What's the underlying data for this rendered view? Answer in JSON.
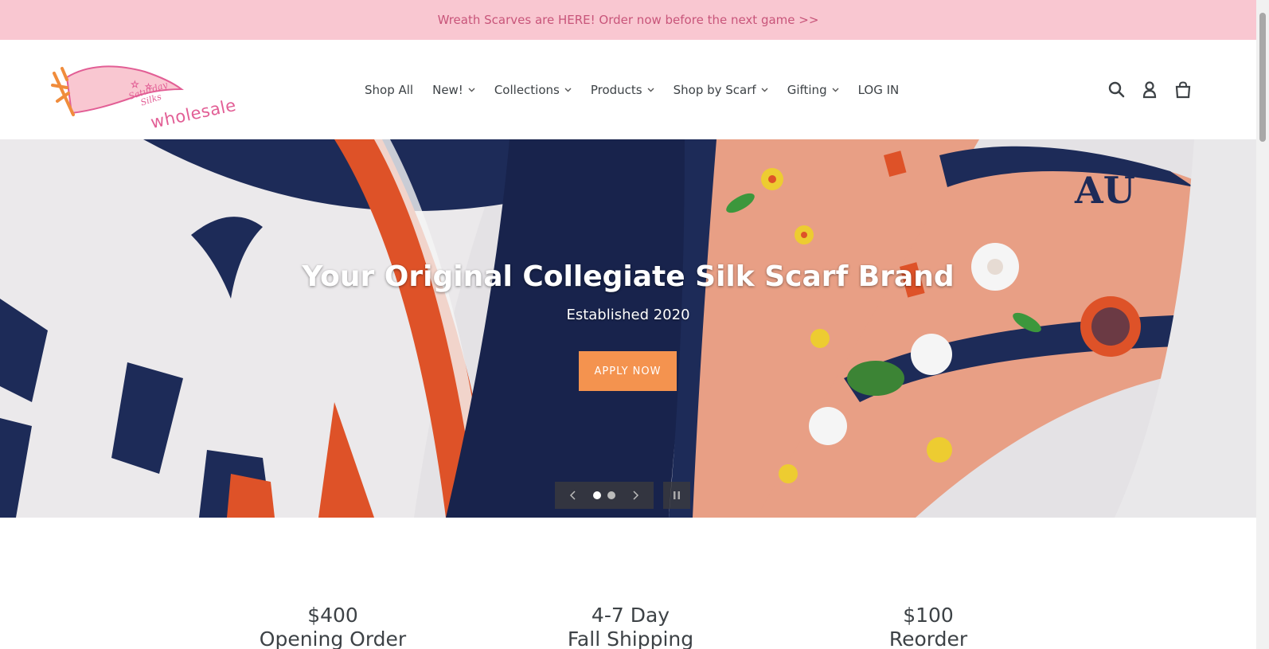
{
  "announcement": {
    "text": "Wreath Scarves are HERE! Order now before the next game >>"
  },
  "logo": {
    "script_text": "Saturday Silks",
    "word": "wholesale",
    "alt": "Saturday Silks wholesale logo"
  },
  "nav": {
    "items": [
      {
        "label": "Shop All",
        "has_dropdown": false
      },
      {
        "label": "New!",
        "has_dropdown": true
      },
      {
        "label": "Collections",
        "has_dropdown": true
      },
      {
        "label": "Products",
        "has_dropdown": true
      },
      {
        "label": "Shop by Scarf",
        "has_dropdown": true
      },
      {
        "label": "Gifting",
        "has_dropdown": true
      },
      {
        "label": "LOG IN",
        "has_dropdown": false
      }
    ]
  },
  "header_icons": [
    "search-icon",
    "account-icon",
    "cart-icon"
  ],
  "hero": {
    "title": "Your Original Collegiate Silk Scarf Brand",
    "subtitle": "Established 2020",
    "button_label": "APPLY NOW",
    "slide_count": 2,
    "active_slide": 1
  },
  "features": [
    {
      "line1": "$400",
      "line2": "Opening Order"
    },
    {
      "line1": "4-7 Day",
      "line2": "Fall Shipping"
    },
    {
      "line1": "$100",
      "line2": "Reorder"
    }
  ],
  "colors": {
    "announcement_bg": "#f9c7d1",
    "announcement_text": "#c8557a",
    "accent_button": "#f4934f",
    "logo_pink": "#e25e95",
    "logo_orange": "#f08c3c",
    "navy": "#1f2d5c"
  }
}
